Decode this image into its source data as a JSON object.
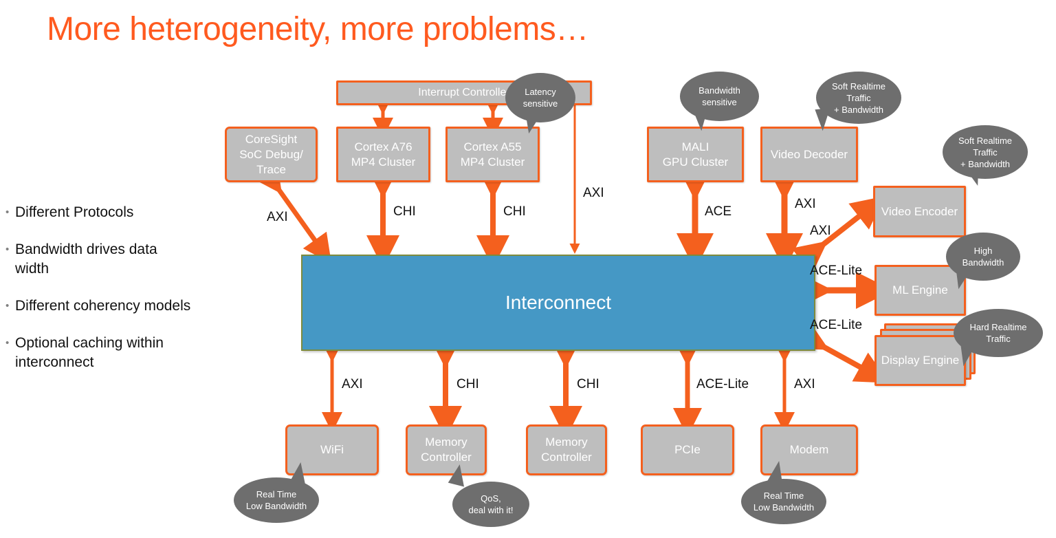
{
  "slide": {
    "title": "More heterogeneity, more problems…",
    "title_color": "#FF5A1F",
    "background": "#FFFFFF"
  },
  "colors": {
    "accent_orange": "#F4601E",
    "title_orange": "#FF5A1F",
    "block_gray": "#BEBEBE",
    "callout_gray": "#6E6E6E",
    "interconnect_blue": "#4598C5",
    "interconnect_border": "#7E8B3D",
    "text_dark": "#111111",
    "block_text": "#FFFFFF"
  },
  "bullets": [
    {
      "text": "Different Protocols"
    },
    {
      "text": "Bandwidth drives data width"
    },
    {
      "text": "Different coherency models"
    },
    {
      "text": "Optional caching within interconnect"
    }
  ],
  "interconnect": {
    "label": "Interconnect"
  },
  "blocks": [
    {
      "id": "interrupt-controller",
      "label": "Interrupt Controller"
    },
    {
      "id": "coresight",
      "label": "CoreSight\nSoC Debug/\nTrace"
    },
    {
      "id": "cortex-a76",
      "label": "Cortex A76\nMP4 Cluster"
    },
    {
      "id": "cortex-a55",
      "label": "Cortex A55\nMP4 Cluster"
    },
    {
      "id": "mali-gpu",
      "label": "MALI\nGPU Cluster"
    },
    {
      "id": "video-decoder",
      "label": "Video Decoder"
    },
    {
      "id": "video-encoder",
      "label": "Video Encoder"
    },
    {
      "id": "ml-engine",
      "label": "ML Engine"
    },
    {
      "id": "display-engine",
      "label": "Display Engine"
    },
    {
      "id": "wifi",
      "label": "WiFi"
    },
    {
      "id": "memory-controller-1",
      "label": "Memory\nController"
    },
    {
      "id": "memory-controller-2",
      "label": "Memory\nController"
    },
    {
      "id": "pcie",
      "label": "PCIe"
    },
    {
      "id": "modem",
      "label": "Modem"
    }
  ],
  "protocol_labels": [
    {
      "id": "axi-coresight",
      "text": "AXI"
    },
    {
      "id": "chi-a76",
      "text": "CHI"
    },
    {
      "id": "chi-a55",
      "text": "CHI"
    },
    {
      "id": "axi-interrupt",
      "text": "AXI"
    },
    {
      "id": "ace-mali",
      "text": "ACE"
    },
    {
      "id": "axi-vdec",
      "text": "AXI"
    },
    {
      "id": "axi-venc",
      "text": "AXI"
    },
    {
      "id": "ace-lite-ml",
      "text": "ACE-Lite"
    },
    {
      "id": "ace-lite-disp",
      "text": "ACE-Lite"
    },
    {
      "id": "axi-wifi",
      "text": "AXI"
    },
    {
      "id": "chi-mc1",
      "text": "CHI"
    },
    {
      "id": "chi-mc2",
      "text": "CHI"
    },
    {
      "id": "ace-lite-pcie",
      "text": "ACE-Lite"
    },
    {
      "id": "axi-modem",
      "text": "AXI"
    }
  ],
  "callouts": [
    {
      "id": "latency-sensitive",
      "text": "Latency\nsensitive"
    },
    {
      "id": "bandwidth-sensitive",
      "text": "Bandwidth\nsensitive"
    },
    {
      "id": "soft-realtime-vdec",
      "text": "Soft Realtime\nTraffic\n+ Bandwidth"
    },
    {
      "id": "soft-realtime-venc",
      "text": "Soft Realtime\nTraffic\n+ Bandwidth"
    },
    {
      "id": "high-bandwidth-ml",
      "text": "High\nBandwidth"
    },
    {
      "id": "hard-realtime-display",
      "text": "Hard Realtime\nTraffic"
    },
    {
      "id": "realtime-low-bw-wifi",
      "text": "Real Time\nLow Bandwidth"
    },
    {
      "id": "qos-memory",
      "text": "QoS,\ndeal with it!"
    },
    {
      "id": "realtime-low-bw-modem",
      "text": "Real Time\nLow Bandwidth"
    }
  ]
}
